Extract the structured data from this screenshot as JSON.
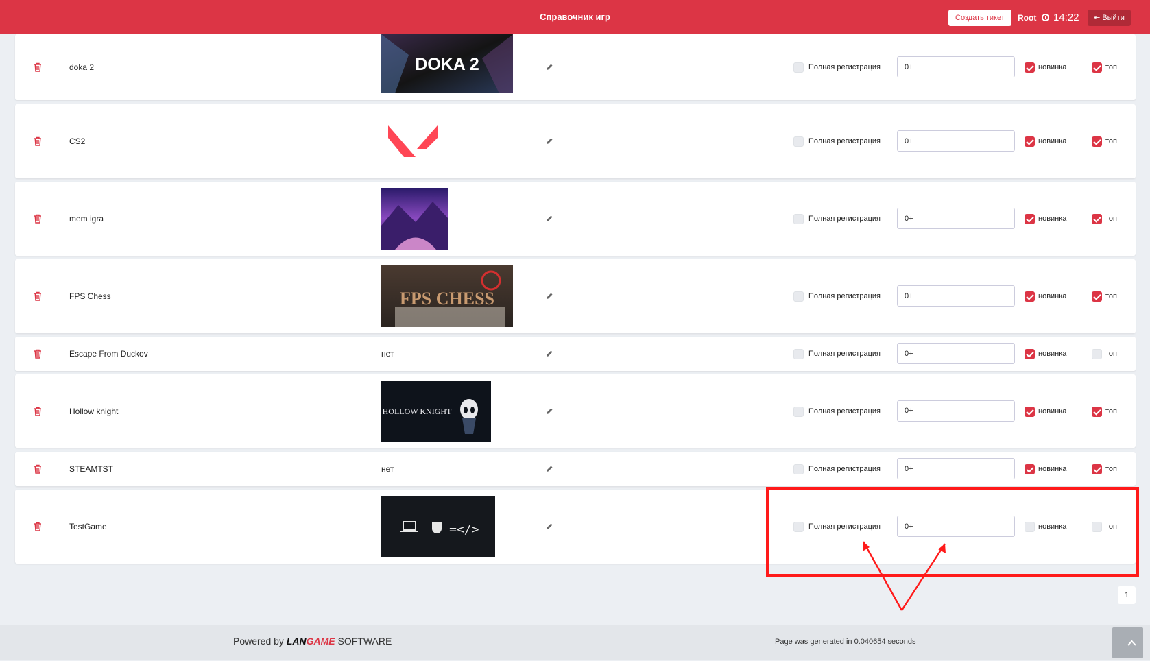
{
  "header": {
    "title": "Справочник игр",
    "create_ticket_label": "Создать тикет",
    "user": "Root",
    "time": "14:22",
    "logout_label": "Выйти"
  },
  "labels": {
    "full_registration": "Полная регистрация",
    "novelty": "новинка",
    "top": "топ",
    "no_image": "нет"
  },
  "games": [
    {
      "name": "doka 2",
      "image": "doka2-art",
      "image_title": "DOKA 2",
      "age": "0+",
      "full_registration": false,
      "novelty": true,
      "top": true
    },
    {
      "name": "CS2",
      "image": "valorant-logo",
      "age": "0+",
      "full_registration": false,
      "novelty": true,
      "top": true
    },
    {
      "name": "mem igra",
      "image": "purple-landscape",
      "age": "0+",
      "full_registration": false,
      "novelty": true,
      "top": true
    },
    {
      "name": "FPS Chess",
      "image": "fps-chess-art",
      "image_title": "FPS CHESS",
      "age": "0+",
      "full_registration": false,
      "novelty": true,
      "top": true
    },
    {
      "name": "Escape From Duckov",
      "image": null,
      "age": "0+",
      "full_registration": false,
      "novelty": true,
      "top": false
    },
    {
      "name": "Hollow knight",
      "image": "hollow-knight-art",
      "image_title": "HOLLOW KNIGHT",
      "age": "0+",
      "full_registration": false,
      "novelty": true,
      "top": true
    },
    {
      "name": "STEAMTST",
      "image": null,
      "age": "0+",
      "full_registration": false,
      "novelty": true,
      "top": true
    },
    {
      "name": "TestGame",
      "image": "laptop-coffee-code",
      "image_title": "+ =</>",
      "age": "0+",
      "full_registration": false,
      "novelty": false,
      "top": false
    }
  ],
  "pagination": {
    "current_page": "1"
  },
  "footer": {
    "powered_prefix": "Powered by",
    "brand_part1": "LAN",
    "brand_part2": "GAME",
    "brand_suffix": "SOFTWARE",
    "generated_text": "Page was generated in 0.040654 seconds"
  },
  "colors": {
    "accent": "#dc3545",
    "annotation": "#ff1a1a"
  }
}
